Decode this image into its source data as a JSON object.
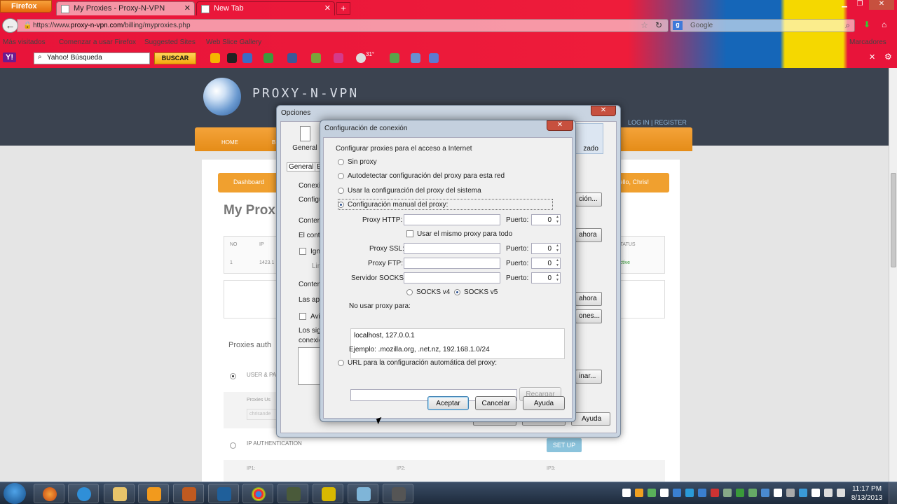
{
  "browser": {
    "menu_label": "Firefox",
    "tabs": [
      {
        "title": "My Proxies - Proxy-N-VPN",
        "active": true
      },
      {
        "title": "New Tab",
        "active": false
      }
    ],
    "url_scheme": "https://www.",
    "url_domain": "proxy-n-vpn.com",
    "url_path": "/billing/myproxies.php",
    "search_placeholder": "Google",
    "bookmarks": [
      "Más visitados",
      "Comenzar a usar Firefox",
      "Suggested Sites",
      "Web Slice Gallery"
    ],
    "bookmarks_right": "Marcadores",
    "yahoo": {
      "search_value": "Yahoo! Búsqueda",
      "search_button": "BUSCAR",
      "weather": "31°"
    }
  },
  "site": {
    "title": "PROXY-N-VPN",
    "login_link": "LOG IN | REGISTER",
    "nav": [
      "HOME",
      "B"
    ],
    "subnav": {
      "dashboard": "Dashboard",
      "greeting": "Hello, Chris!"
    },
    "page_title": "My Proxies",
    "table": {
      "headers": [
        "NO",
        "IP",
        "STATUS"
      ],
      "row": {
        "no": "1",
        "ip": "1423.1",
        "status": "Active"
      }
    },
    "proxies_auth": "Proxies auth",
    "user_pass": "USER & PA",
    "proxies_user_label": "Proxies Us",
    "proxies_user_value": "chrisande",
    "ip_auth": "IP AUTHENTICATION",
    "setup_button": "SET UP",
    "ip_labels": [
      "IP1:",
      "IP2:",
      "IP3:"
    ]
  },
  "options_dialog": {
    "title": "Opciones",
    "general_tab": "General",
    "advanced_tab": "zado",
    "subtabs": [
      "General",
      "El"
    ],
    "side_labels": [
      "Conexió",
      "Configu",
      "Conten",
      "El conte",
      "Ign",
      "Lim",
      "Conten",
      "Las apli",
      "Avi",
      "Los sig",
      "conexió"
    ],
    "side_buttons": [
      "ción...",
      "ahora",
      "ahora",
      "ones...",
      "inar..."
    ],
    "help_button": "Ayuda"
  },
  "connection_dialog": {
    "title": "Configuración de conexión",
    "heading": "Configurar proxies para el acceso a Internet",
    "options": [
      {
        "label": "Sin proxy",
        "selected": false
      },
      {
        "label": "Autodetectar configuración del proxy para esta red",
        "selected": false
      },
      {
        "label": "Usar la configuración del proxy del sistema",
        "selected": false
      },
      {
        "label": "Configuración manual del proxy:",
        "selected": true
      }
    ],
    "http_label": "Proxy HTTP:",
    "port_label": "Puerto:",
    "http_port": "0",
    "same_proxy_label": "Usar el mismo proxy para todo",
    "ssl_label": "Proxy SSL:",
    "ssl_port": "0",
    "ftp_label": "Proxy FTP:",
    "ftp_port": "0",
    "socks_label": "Servidor SOCKS:",
    "socks_port": "0",
    "socks_v4": "SOCKS v4",
    "socks_v5": "SOCKS v5",
    "socks_version_selected": "v5",
    "no_proxy_label": "No usar proxy para:",
    "no_proxy_value": "localhost, 127.0.0.1",
    "example": "Ejemplo: .mozilla.org, .net.nz, 192.168.1.0/24",
    "pac_label": "URL para la configuración automática del proxy:",
    "reload_button": "Recargar",
    "accept_button": "Aceptar",
    "cancel_button": "Cancelar",
    "help_button": "Ayuda"
  },
  "taskbar": {
    "time": "11:17 PM",
    "date": "8/13/2013"
  },
  "colors": {
    "site_orange": "#f0a02f",
    "site_header": "#3b4350",
    "dialog_frame": "#c4d0de"
  }
}
